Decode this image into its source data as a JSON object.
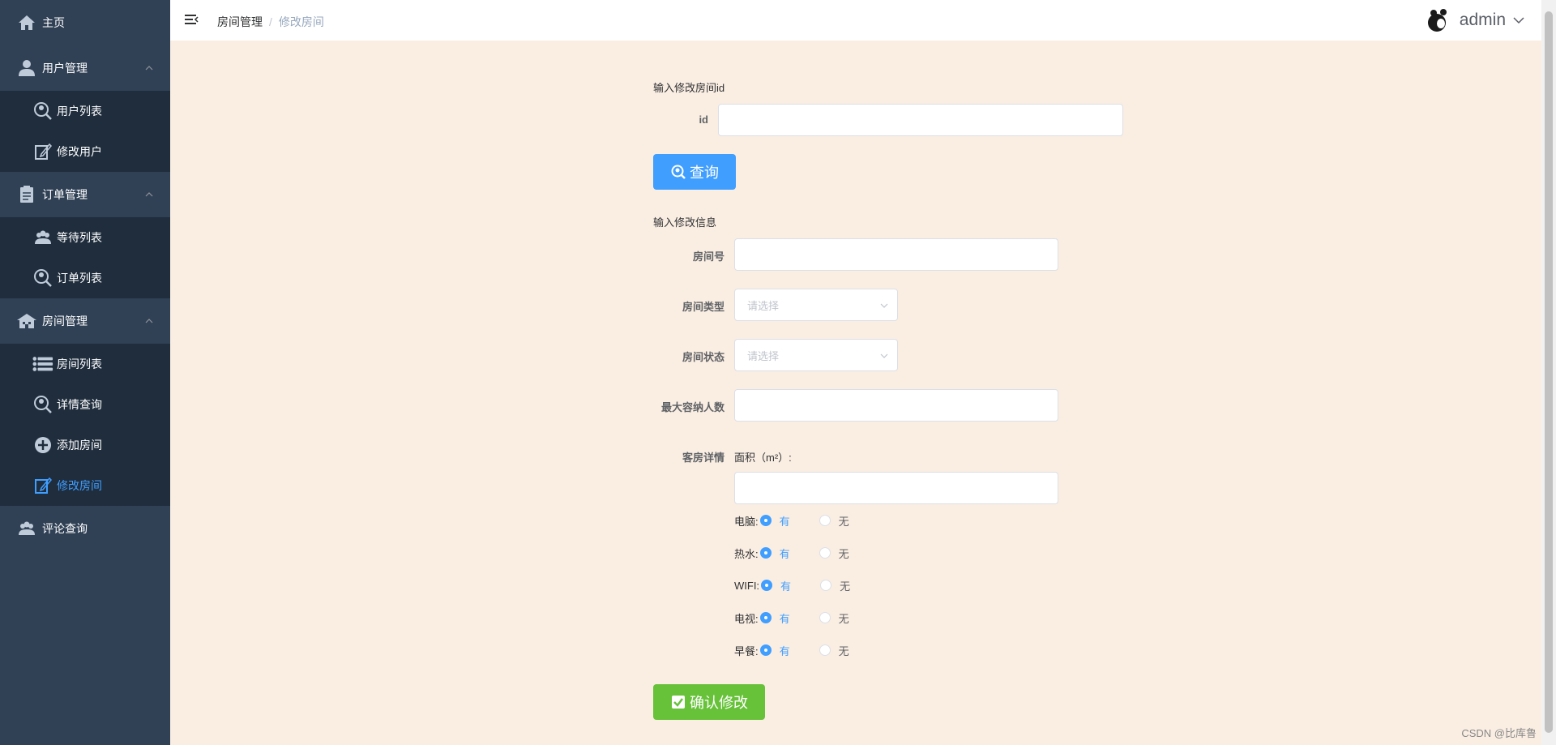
{
  "sidebar": {
    "home": "主页",
    "user_mgmt": "用户管理",
    "user_list": "用户列表",
    "edit_user": "修改用户",
    "order_mgmt": "订单管理",
    "waiting_list": "等待列表",
    "order_list": "订单列表",
    "room_mgmt": "房间管理",
    "room_list": "房间列表",
    "detail_query": "详情查询",
    "add_room": "添加房间",
    "edit_room": "修改房间",
    "comment_query": "评论查询"
  },
  "header": {
    "breadcrumb_1": "房间管理",
    "breadcrumb_sep": "/",
    "breadcrumb_2": "修改房间",
    "username": "admin"
  },
  "form": {
    "id_section_title": "输入修改房间id",
    "id_label": "id",
    "id_value": "",
    "query_button": "查询",
    "info_section_title": "输入修改信息",
    "room_no_label": "房间号",
    "room_no_value": "",
    "room_type_label": "房间类型",
    "room_type_placeholder": "请选择",
    "room_status_label": "房间状态",
    "room_status_placeholder": "请选择",
    "max_people_label": "最大容纳人数",
    "max_people_value": "",
    "detail_label": "客房详情",
    "area_label": "面积（m²）:",
    "area_value": "",
    "amenities": [
      {
        "label": "电脑:",
        "yes": "有",
        "no": "无",
        "selected": "有"
      },
      {
        "label": "热水:",
        "yes": "有",
        "no": "无",
        "selected": "有"
      },
      {
        "label": "WIFI:",
        "yes": "有",
        "no": "无",
        "selected": "有"
      },
      {
        "label": "电视:",
        "yes": "有",
        "no": "无",
        "selected": "有"
      },
      {
        "label": "早餐:",
        "yes": "有",
        "no": "无",
        "selected": "有"
      }
    ],
    "submit_button": "确认修改"
  },
  "watermark": "CSDN @比库鲁",
  "colors": {
    "sidebar_bg": "#304156",
    "submenu_bg": "#1f2d3d",
    "content_bg": "#faeee3",
    "primary": "#409eff",
    "success": "#67c23a"
  }
}
